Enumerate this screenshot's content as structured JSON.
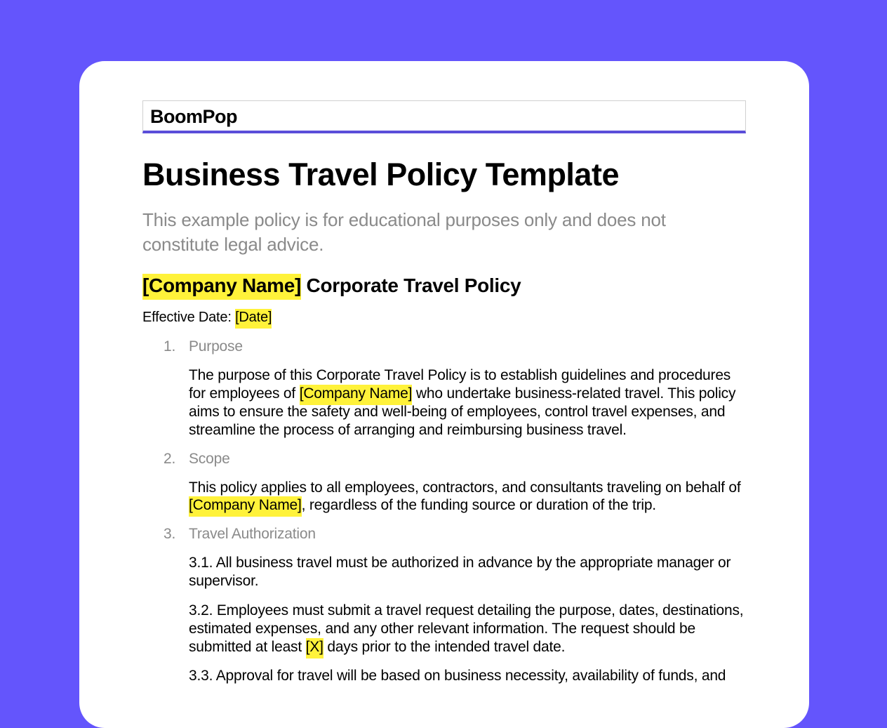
{
  "header": {
    "brand": "BoomPop"
  },
  "title": "Business Travel Policy Template",
  "disclaimer": "This example policy is for educational purposes only and does not constitute legal advice.",
  "company_heading": {
    "placeholder": "[Company Name]",
    "suffix": " Corporate Travel Policy"
  },
  "effective_date": {
    "label": "Effective Date: ",
    "placeholder": "[Date]"
  },
  "sections": {
    "purpose": {
      "title": "Purpose",
      "body_pre": "The purpose of this Corporate Travel Policy is to establish guidelines and procedures for employees of ",
      "body_placeholder": "[Company Name]",
      "body_post": " who undertake business-related travel. This policy aims to ensure the safety and well-being of employees, control travel expenses, and streamline the process of arranging and reimbursing business travel."
    },
    "scope": {
      "title": "Scope",
      "body_pre": "This policy applies to all employees, contractors, and consultants traveling on behalf of ",
      "body_placeholder": "[Company Name]",
      "body_post": ", regardless of the funding source or duration of the trip."
    },
    "travel_auth": {
      "title": "Travel Authorization",
      "item_3_1": "3.1. All business travel must be authorized in advance by the appropriate manager or supervisor.",
      "item_3_2_pre": "3.2. Employees must submit a travel request detailing the purpose, dates, destinations, estimated expenses, and any other relevant information. The request should be submitted at least ",
      "item_3_2_placeholder": "[X]",
      "item_3_2_post": " days prior to the intended travel date.",
      "item_3_3": "3.3. Approval for travel will be based on business necessity, availability of funds, and"
    }
  }
}
